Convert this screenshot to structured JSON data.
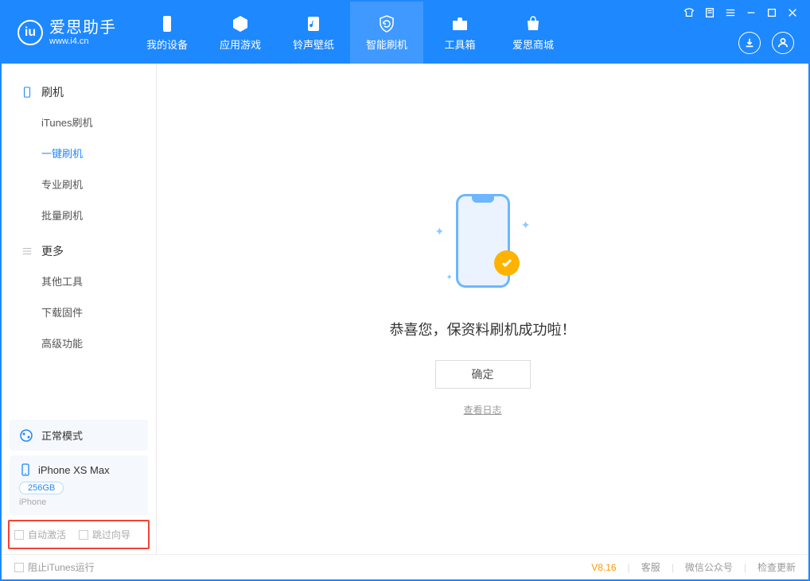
{
  "app": {
    "title": "爱思助手",
    "subtitle": "www.i4.cn"
  },
  "nav": [
    {
      "label": "我的设备"
    },
    {
      "label": "应用游戏"
    },
    {
      "label": "铃声壁纸"
    },
    {
      "label": "智能刷机"
    },
    {
      "label": "工具箱"
    },
    {
      "label": "爱思商城"
    }
  ],
  "sidebar": {
    "section1": {
      "title": "刷机",
      "items": [
        "iTunes刷机",
        "一键刷机",
        "专业刷机",
        "批量刷机"
      ]
    },
    "section2": {
      "title": "更多",
      "items": [
        "其他工具",
        "下载固件",
        "高级功能"
      ]
    },
    "mode": "正常模式",
    "device": {
      "name": "iPhone XS Max",
      "storage": "256GB",
      "type": "iPhone"
    },
    "checkboxes": {
      "auto_activate": "自动激活",
      "skip_guide": "跳过向导"
    }
  },
  "main": {
    "success_text": "恭喜您，保资料刷机成功啦！",
    "ok_button": "确定",
    "view_log": "查看日志"
  },
  "footer": {
    "block_itunes": "阻止iTunes运行",
    "version": "V8.16",
    "links": [
      "客服",
      "微信公众号",
      "检查更新"
    ]
  }
}
